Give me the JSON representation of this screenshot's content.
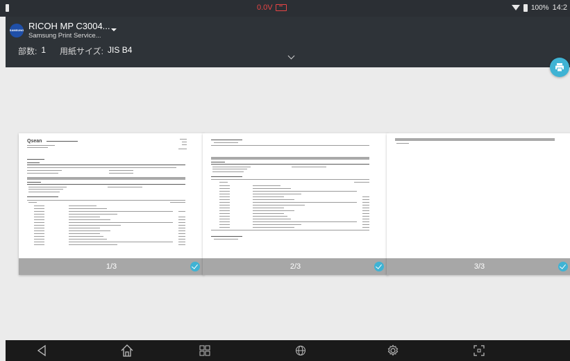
{
  "status_bar": {
    "voltage_text": "0.0V",
    "battery_text": "100%",
    "time": "14:2"
  },
  "header": {
    "brand_icon_text": "SAMSUNG",
    "printer_name": "RICOH MP C3004...",
    "service_name": "Samsung Print Service...",
    "copies_label": "部数:",
    "copies_value": "1",
    "paper_size_label": "用紙サイズ:",
    "paper_size_value": "JIS B4"
  },
  "fab": {
    "icon": "print-icon"
  },
  "pages": [
    {
      "label": "1/3",
      "selected": true
    },
    {
      "label": "2/3",
      "selected": true
    },
    {
      "label": "3/3",
      "selected": true
    }
  ],
  "colors": {
    "header_bg": "#2e3338",
    "accent": "#3fb3d4",
    "page_footer": "#a7a7a7",
    "nav_bg": "#1a1a1a",
    "error_red": "#e84545"
  },
  "nav_bar": {
    "buttons": [
      "back-icon",
      "home-icon",
      "recents-icon",
      "browser-icon",
      "settings-icon",
      "screenshot-icon"
    ]
  }
}
